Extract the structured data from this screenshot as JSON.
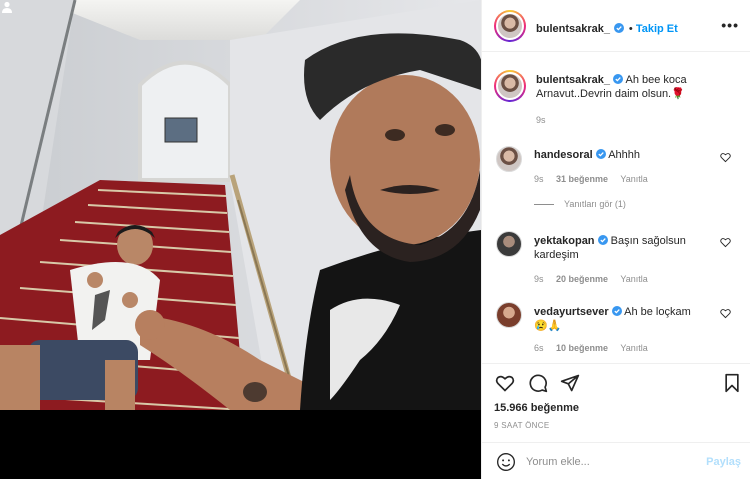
{
  "post": {
    "author": "bulentsakrak_",
    "follow_label": "Takip Et",
    "more_label": "•••",
    "caption": "Ah bee koca Arnavut..Devrin daim olsun.",
    "caption_emoji": "🌹",
    "caption_age": "9s",
    "likes_count": "15.966 beğenme",
    "time_ago": "9 SAAT ÖNCE",
    "view_replies": "Yanıtları gör (1)"
  },
  "comments": [
    {
      "user": "handesoral",
      "text": "Ahhhh",
      "age": "9s",
      "likes": "31 beğenme",
      "reply": "Yanıtla"
    },
    {
      "user": "yektakopan",
      "text": "Başın sağolsun kardeşim",
      "age": "9s",
      "likes": "20 beğenme",
      "reply": "Yanıtla"
    },
    {
      "user": "vedayurtsever",
      "text": "Ah be loçkam",
      "text2": "😢🙏",
      "age": "6s",
      "likes": "10 beğenme",
      "reply": "Yanıtla"
    }
  ],
  "composer": {
    "placeholder": "Yorum ekle...",
    "post_label": "Paylaş"
  },
  "icons": {
    "verified": "verified-badge-icon",
    "heart": "heart-icon",
    "comment": "comment-icon",
    "share": "share-icon",
    "save": "bookmark-icon",
    "emoji": "emoji-icon",
    "tag": "user-tag-icon"
  },
  "colors": {
    "accent": "#0095f6",
    "verified": "#3897f0",
    "muted": "#8e8e8e",
    "post_disabled": "#b2dffc"
  }
}
